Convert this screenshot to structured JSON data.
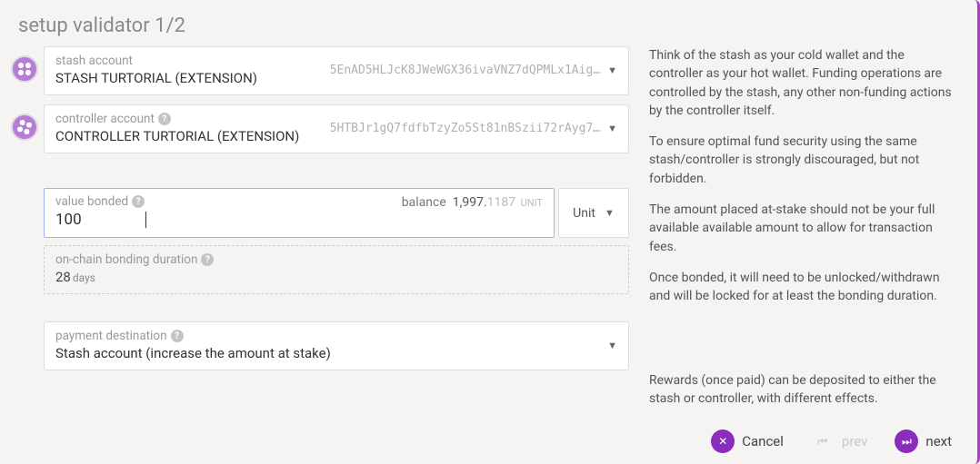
{
  "title": "setup validator 1/2",
  "stash": {
    "label": "stash account",
    "name": "STASH TURTORIAL (EXTENSION)",
    "address": "5EnAD5HLJcK8JWeWGX36ivaVNZ7dQPMLx1Aig…"
  },
  "controller": {
    "label": "controller account",
    "name": "CONTROLLER TURTORIAL (EXTENSION)",
    "address": "5HTBJr1gQ7fdfbTzyZo5St81nBSzii72rAyg7…"
  },
  "bonded": {
    "label": "value bonded",
    "value": "100",
    "balance_label": "balance",
    "balance_whole": "1,997.",
    "balance_frac": "1187",
    "balance_unit": "UNIT",
    "unit_dd": "Unit"
  },
  "duration": {
    "label": "on-chain bonding duration",
    "value": "28",
    "unit": "days"
  },
  "destination": {
    "label": "payment destination",
    "value": "Stash account (increase the amount at stake)"
  },
  "help": {
    "p1": "Think of the stash as your cold wallet and the controller as your hot wallet. Funding operations are controlled by the stash, any other non-funding actions by the controller itself.",
    "p2": "To ensure optimal fund security using the same stash/controller is strongly discouraged, but not forbidden.",
    "p3": "The amount placed at-stake should not be your full available available amount to allow for transaction fees.",
    "p4": "Once bonded, it will need to be unlocked/withdrawn and will be locked for at least the bonding duration.",
    "p5": "Rewards (once paid) can be deposited to either the stash or controller, with different effects."
  },
  "footer": {
    "cancel": "Cancel",
    "prev": "prev",
    "next": "next"
  }
}
